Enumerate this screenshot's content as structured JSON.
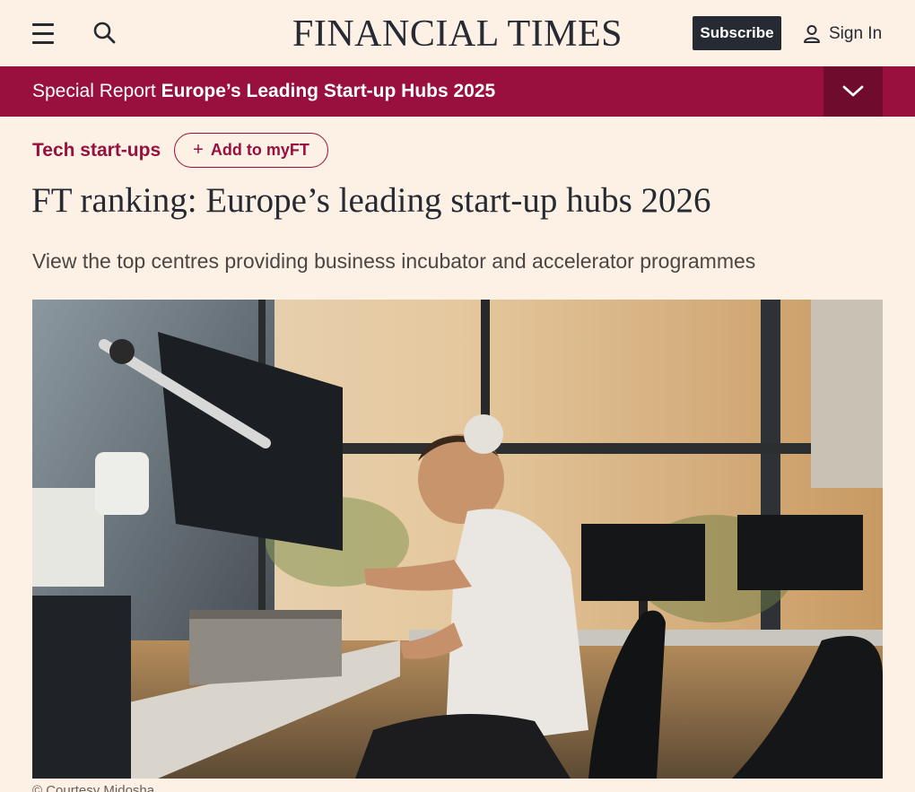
{
  "header": {
    "brand": "FINANCIAL TIMES",
    "subscribe_label": "Subscribe",
    "signin_label": "Sign In",
    "icons": [
      "menu-icon",
      "search-icon",
      "user-icon"
    ]
  },
  "special_report": {
    "label": "Special Report",
    "title": "Europe’s Leading Start-up Hubs 2025",
    "toggle_icon": "chevron-down-icon"
  },
  "article": {
    "topic": "Tech start-ups",
    "add_to_myft": "Add to myFT",
    "add_icon": "+",
    "headline": "FT ranking: Europe’s leading start-up hubs 2026",
    "standfirst": "View the top centres providing business incubator and accelerator programmes",
    "image_alt_subject": "Man working on electronics at a lab bench",
    "caption": "© Courtesy Midosha"
  },
  "colors": {
    "background": "#fdf1e6",
    "claret": "#990f3d",
    "claret_dark": "#6f0b2c",
    "ink": "#262a33"
  }
}
